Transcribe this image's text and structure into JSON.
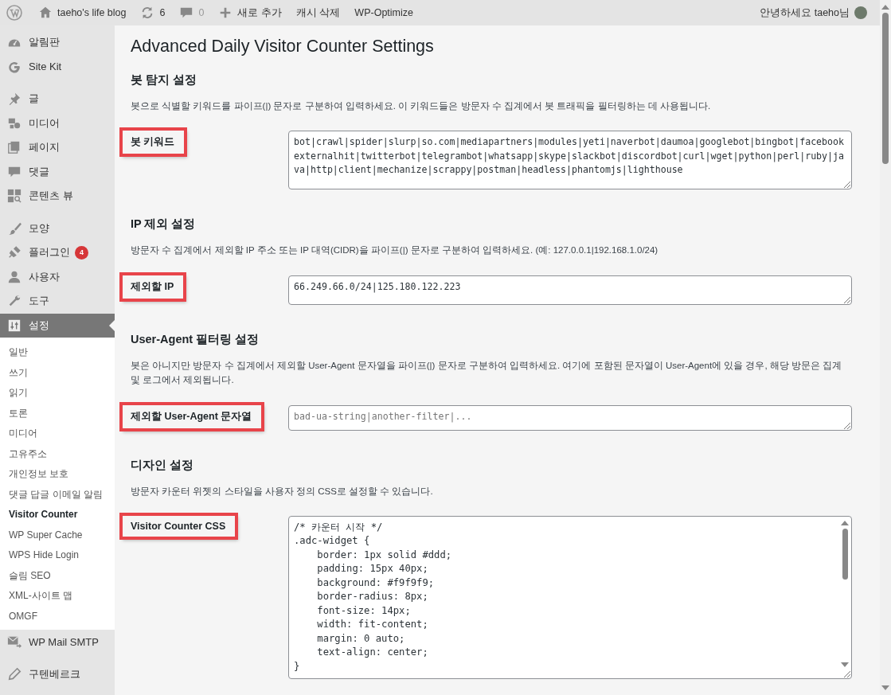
{
  "admin_bar": {
    "site_name": "taeho's life blog",
    "updates": "6",
    "comments": "0",
    "new": "새로 추가",
    "items": [
      "캐시 삭제",
      "WP-Optimize"
    ],
    "greeting": "안녕하세요 taeho님"
  },
  "sidebar": {
    "groups": [
      {
        "items": [
          {
            "label": "알림판",
            "selected": false
          },
          {
            "label": "Site Kit",
            "selected": false
          }
        ]
      },
      {
        "items": [
          {
            "label": "글",
            "selected": false
          },
          {
            "label": "미디어",
            "selected": false
          },
          {
            "label": "페이지",
            "selected": false
          },
          {
            "label": "댓글",
            "selected": false
          },
          {
            "label": "콘텐츠 뷰",
            "selected": false
          }
        ]
      },
      {
        "items": [
          {
            "label": "모양",
            "selected": false
          },
          {
            "label": "플러그인",
            "badge": "4",
            "selected": false
          },
          {
            "label": "사용자",
            "selected": false
          },
          {
            "label": "도구",
            "selected": false
          },
          {
            "label": "설정",
            "selected": true,
            "children": [
              {
                "label": "일반",
                "selected": false
              },
              {
                "label": "쓰기",
                "selected": false
              },
              {
                "label": "읽기",
                "selected": false
              },
              {
                "label": "토론",
                "selected": false
              },
              {
                "label": "미디어",
                "selected": false
              },
              {
                "label": "고유주소",
                "selected": false
              },
              {
                "label": "개인정보 보호",
                "selected": false
              },
              {
                "label": "댓글 답글 이메일 알림",
                "selected": false
              },
              {
                "label": "Visitor Counter",
                "selected": true
              },
              {
                "label": "WP Super Cache",
                "selected": false
              },
              {
                "label": "WPS Hide Login",
                "selected": false
              },
              {
                "label": "슬림 SEO",
                "selected": false
              },
              {
                "label": "XML-사이트 맵",
                "selected": false
              },
              {
                "label": "OMGF",
                "selected": false
              }
            ]
          },
          {
            "label": "WP Mail SMTP",
            "selected": false
          }
        ]
      },
      {
        "items": [
          {
            "label": "구텐베르크",
            "selected": false
          }
        ]
      }
    ]
  },
  "page": {
    "title": "Advanced Daily Visitor Counter Settings",
    "sections": [
      {
        "heading": "봇 탐지 설정",
        "description": "봇으로 식별할 키워드를 파이프(|) 문자로 구분하여 입력하세요. 이 키워드들은 방문자 수 집계에서 봇 트래픽을 필터링하는 데 사용됩니다.",
        "fields": [
          {
            "label": "봇 키워드",
            "highlighted": true,
            "kind": "tall",
            "value": "bot|crawl|spider|slurp|so.com|mediapartners|modules|yeti|naverbot|daumoa|googlebot|bingbot|facebookexternalhit|twitterbot|telegrambot|whatsapp|skype|slackbot|discordbot|curl|wget|python|perl|ruby|java|http|client|mechanize|scrappy|postman|headless|phantomjs|lighthouse"
          }
        ]
      },
      {
        "heading": "IP 제외 설정",
        "description": "방문자 수 집계에서 제외할 IP 주소 또는 IP 대역(CIDR)을 파이프(|) 문자로 구분하여 입력하세요. (예: 127.0.0.1|192.168.1.0/24)",
        "fields": [
          {
            "label": "제외할 IP",
            "highlighted": true,
            "kind": "medium",
            "value": "66.249.66.0/24|125.180.122.223"
          }
        ]
      },
      {
        "heading": "User-Agent 필터링 설정",
        "description": "봇은 아니지만 방문자 수 집계에서 제외할 User-Agent 문자열을 파이프(|) 문자로 구분하여 입력하세요. 여기에 포함된 문자열이 User-Agent에 있을 경우, 해당 방문은 집계 및 로그에서 제외됩니다.",
        "fields": [
          {
            "label": "제외할 User-Agent 문자열",
            "highlighted": true,
            "kind": "short",
            "placeholder": "bad-ua-string|another-filter|..."
          }
        ]
      },
      {
        "heading": "디자인 설정",
        "description": "방문자 카운터 위젯의 스타일을 사용자 정의 CSS로 설정할 수 있습니다.",
        "fields": [
          {
            "label": "Visitor Counter CSS",
            "highlighted": true,
            "kind": "code",
            "value": "/* 카운터 시작 */\n.adc-widget {\n    border: 1px solid #ddd;\n    padding: 15px 40px;\n    background: #f9f9f9;\n    border-radius: 8px;\n    font-size: 14px;\n    width: fit-content;\n    margin: 0 auto;\n    text-align: center;\n}"
          }
        ]
      }
    ]
  }
}
